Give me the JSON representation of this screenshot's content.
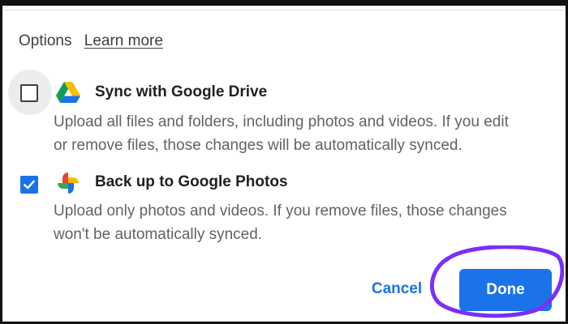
{
  "header": {
    "options_label": "Options",
    "learn_more_link": "Learn more"
  },
  "options": [
    {
      "title": "Sync with Google Drive",
      "description_lines": [
        "Upload all files and folders, including photos and videos. If you edit",
        "or remove files, those changes will be automatically synced."
      ],
      "checked": false,
      "icon": "google-drive-icon"
    },
    {
      "title": "Back up to Google Photos",
      "description_lines": [
        "Upload only photos and videos. If you remove files, those changes",
        "won't be automatically synced."
      ],
      "checked": true,
      "icon": "google-photos-icon"
    }
  ],
  "actions": {
    "cancel_label": "Cancel",
    "done_label": "Done"
  },
  "colors": {
    "accent": "#1a73e8",
    "highlight_ring": "#7b2ff7",
    "text_primary": "#202124",
    "text_secondary": "#5f6368"
  }
}
